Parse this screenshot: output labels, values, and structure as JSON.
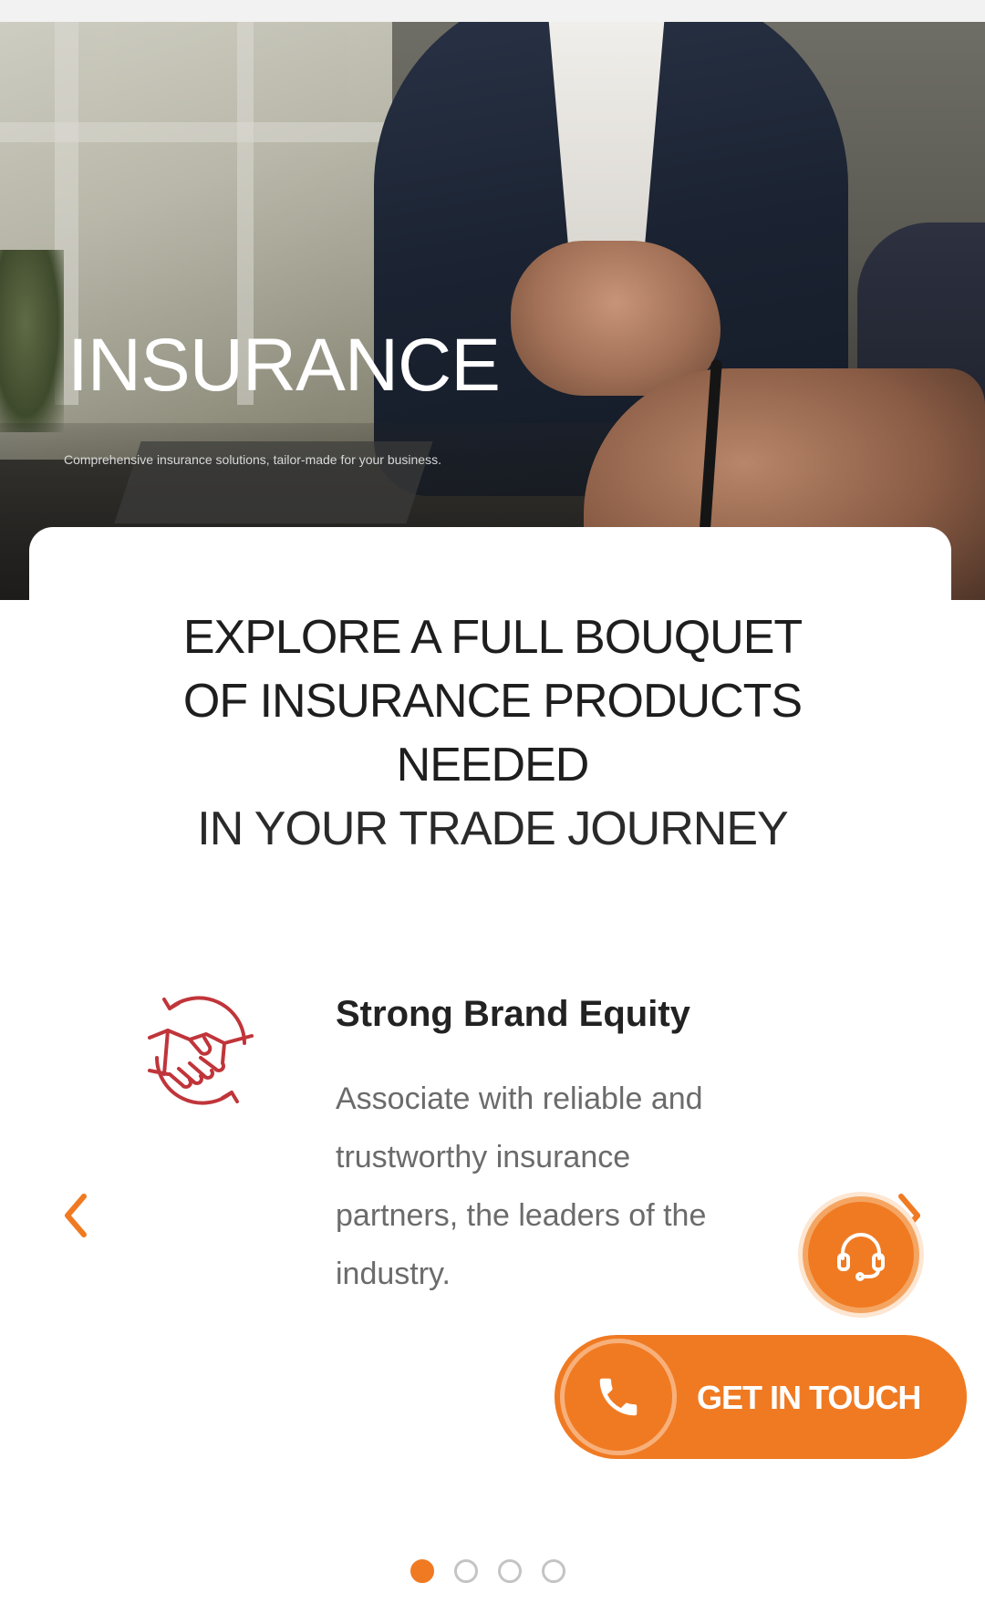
{
  "hero": {
    "title": "INSURANCE",
    "subtitle": "Comprehensive insurance solutions, tailor-made for your business."
  },
  "headline": {
    "line1": "EXPLORE A FULL BOUQUET",
    "line2": "OF INSURANCE PRODUCTS",
    "line3": "NEEDED",
    "line4": "IN YOUR TRADE JOURNEY"
  },
  "feature": {
    "icon": "handshake-icon",
    "title": "Strong Brand Equity",
    "description": "Associate with reliable and trustworthy insurance partners, the leaders of the industry."
  },
  "contact": {
    "label": "GET IN TOUCH",
    "icon": "phone-icon"
  },
  "support": {
    "icon": "headset-icon"
  },
  "carousel": {
    "current_page": 1,
    "total_pages": 4
  },
  "colors": {
    "accent": "#f07a22",
    "icon_red": "#c0353a",
    "text_dark": "#1e1e1e",
    "text_muted": "#6b6b6b"
  }
}
